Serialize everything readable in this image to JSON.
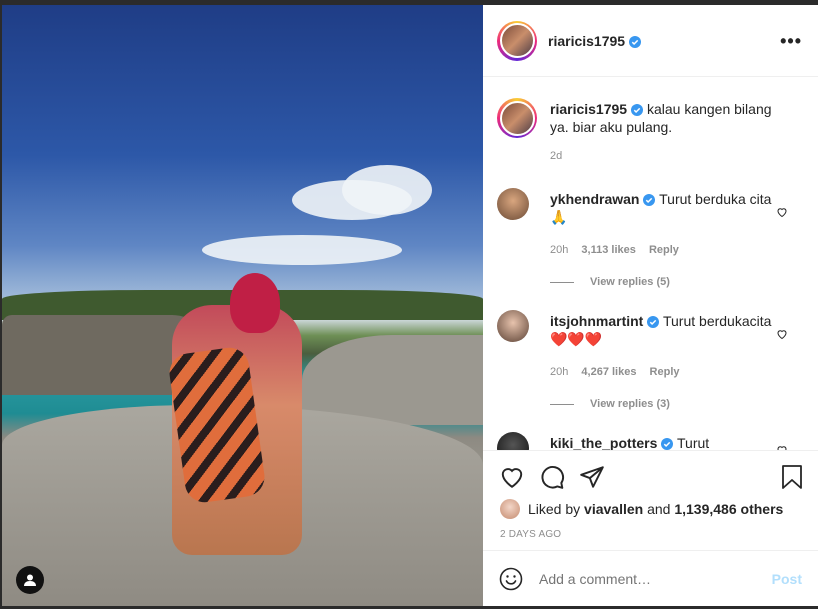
{
  "post": {
    "username": "riaricis1795",
    "more_icon": "•••",
    "caption_user": "riaricis1795",
    "caption_text": "kalau kangen bilang ya. biar aku pulang.",
    "caption_time": "2d"
  },
  "comments": [
    {
      "user": "ykhendrawan",
      "text": "Turut berduka cita🙏",
      "time": "20h",
      "likes": "3,113 likes",
      "reply": "Reply",
      "view_replies": "View replies (5)"
    },
    {
      "user": "itsjohnmartint",
      "text": "Turut berdukacita ❤️❤️❤️",
      "time": "20h",
      "likes": "4,267 likes",
      "reply": "Reply",
      "view_replies": "View replies (3)"
    },
    {
      "user": "kiki_the_potters",
      "text": "Turut"
    }
  ],
  "actions": {
    "liked_prefix": "Liked by",
    "liked_user": "viavallen",
    "liked_and": "and",
    "liked_count": "1,139,486 others",
    "time_ago": "2 DAYS AGO"
  },
  "comment_box": {
    "placeholder": "Add a comment…",
    "post_label": "Post"
  },
  "colors": {
    "verified": "#3897f0",
    "post_disabled": "#b2dffc",
    "meta_gray": "#8e8e8e"
  },
  "icons": [
    "verified-badge-icon",
    "more-options-icon",
    "heart-icon",
    "comment-icon",
    "share-icon",
    "bookmark-icon",
    "emoji-icon",
    "user-tag-icon"
  ]
}
